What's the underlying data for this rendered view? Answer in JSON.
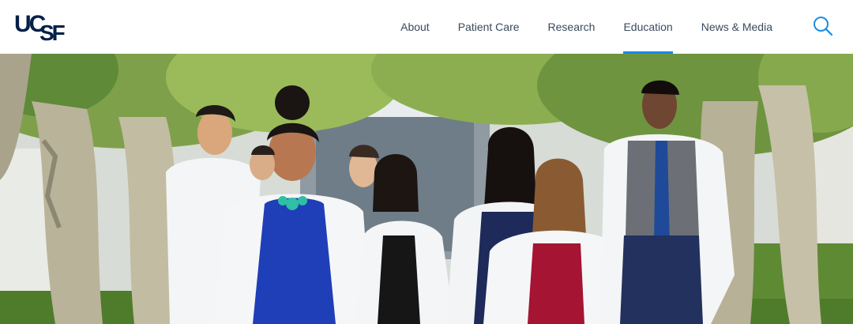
{
  "header": {
    "logo_text_top": "UC",
    "logo_text_bottom": "SF",
    "nav_items": [
      {
        "label": "About",
        "active": false
      },
      {
        "label": "Patient Care",
        "active": false
      },
      {
        "label": "Research",
        "active": false
      },
      {
        "label": "Education",
        "active": true
      },
      {
        "label": "News & Media",
        "active": false
      }
    ],
    "search_icon": "search-icon"
  },
  "hero": {
    "image_subject": "medical-students-walking-photo"
  },
  "colors": {
    "brand_navy": "#052049",
    "nav_text": "#3a4a5e",
    "accent_blue": "#178ce6"
  }
}
